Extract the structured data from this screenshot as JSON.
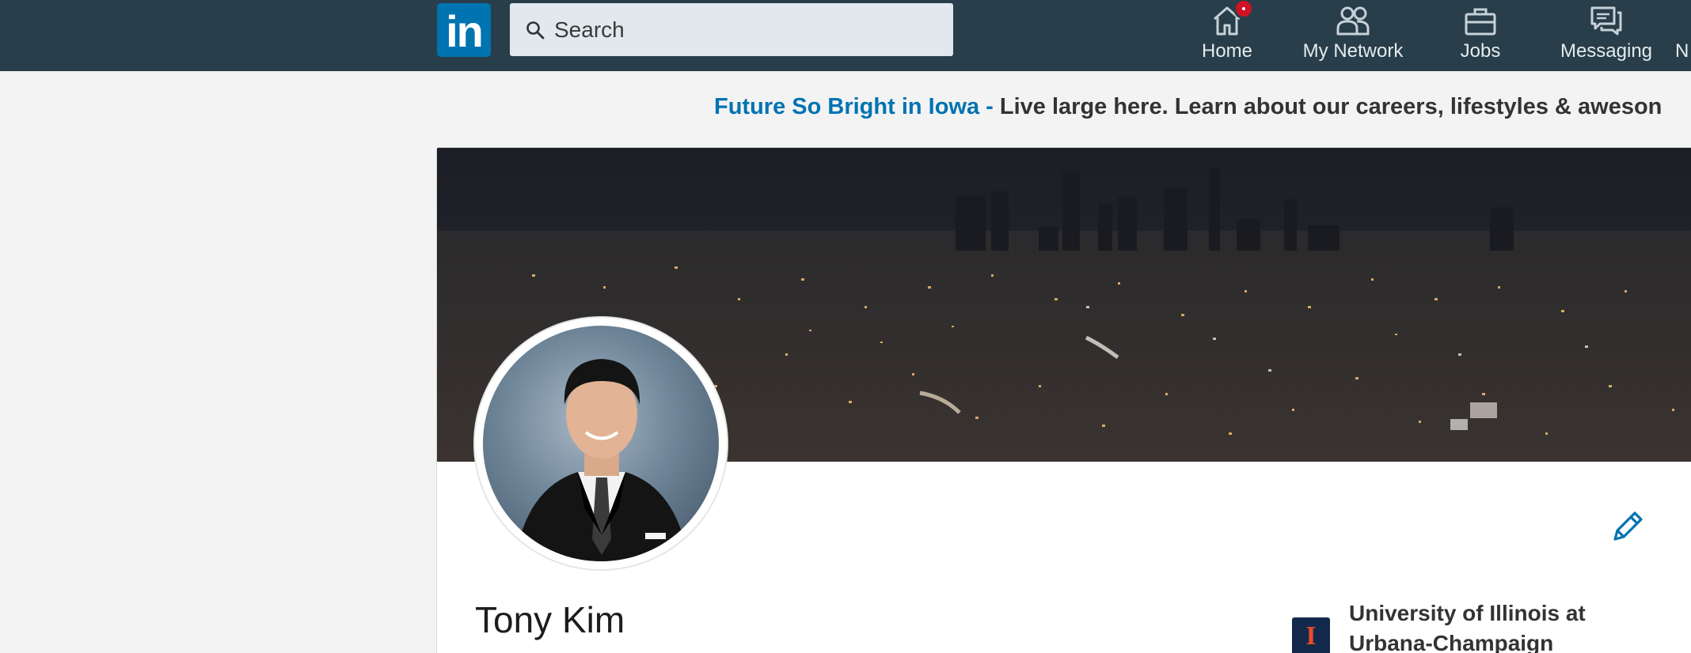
{
  "nav": {
    "logo_text": "in",
    "search_placeholder": "Search",
    "items": [
      {
        "label": "Home",
        "icon": "home-icon",
        "has_badge": true
      },
      {
        "label": "My Network",
        "icon": "network-icon"
      },
      {
        "label": "Jobs",
        "icon": "briefcase-icon"
      },
      {
        "label": "Messaging",
        "icon": "messaging-icon"
      },
      {
        "label": "N",
        "icon": "notifications-icon"
      }
    ]
  },
  "ad": {
    "link": "Future So Bright in Iowa -",
    "text": " Live large here. Learn about our careers, lifestyles & aweson"
  },
  "profile": {
    "name": "Tony Kim",
    "school": "University of Illinois at Urbana-Champaign",
    "school_logo_text": "I"
  },
  "colors": {
    "nav_bg": "#283e4a",
    "brand": "#0073b1",
    "badge": "#d11124"
  }
}
